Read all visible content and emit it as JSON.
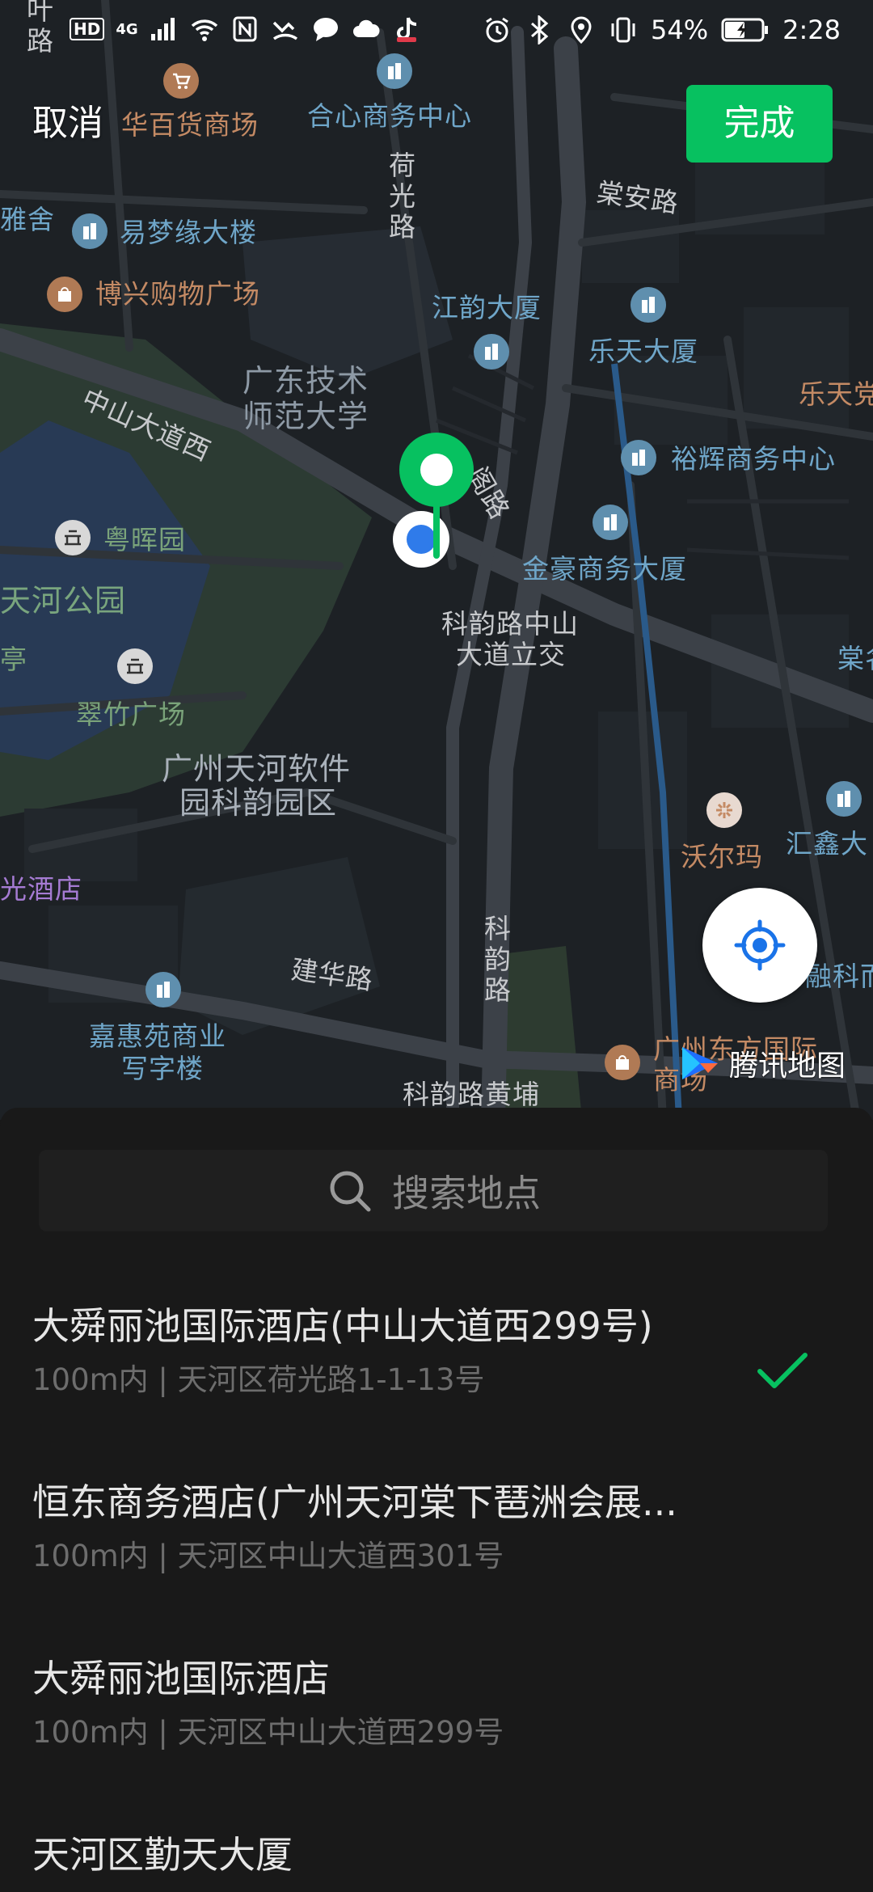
{
  "status_bar": {
    "hd": "HD",
    "net": "4G",
    "battery": "54%",
    "time": "2:28"
  },
  "header": {
    "cancel_label": "取消",
    "done_label": "完成"
  },
  "map": {
    "labels": {
      "ye_lu": "叶路",
      "huabaihuo": "华百货商场",
      "hexin": "合心商务中心",
      "heguang_lu": "荷光路",
      "tangan_lu": "棠安路",
      "yashe": "雅舍",
      "yimengyuan": "易梦缘大楼",
      "boxing": "博兴购物广场",
      "jiangyun": "江韵大厦",
      "letian": "乐天大厦",
      "letian_right": "乐天党",
      "gdjs": "广东技术",
      "gdjs2": "师范大学",
      "zhongshan": "中山大道西",
      "yuhui": "裕辉商务中心",
      "hui_lu": "阁路",
      "yuehuiyuan": "粤晖园",
      "jinhao": "金豪商务大厦",
      "tianhe_park": "天河公园",
      "keyun1": "科韵路中山",
      "keyun2": "大道立交",
      "ting": "亭",
      "cuizhu": "翠竹广场",
      "tang_right": "棠名",
      "software1": "广州天河软件",
      "software2": "园科韵园区",
      "walmart": "沃尔玛",
      "huixin": "汇鑫大",
      "guang_hotel": "光酒店",
      "keyun_lu": "科韵路",
      "jianhua_lu": "建华路",
      "ronghua": "融科而",
      "jiahuiyuan1": "嘉惠苑商业",
      "jiahuiyuan2": "写字楼",
      "huangpu": "科韵路黄埔",
      "guangzhou_dongfang": "广州东方国际",
      "shangchang": "商场"
    },
    "logo_text": "腾讯地图",
    "icons": [
      "cart-icon",
      "building-icon",
      "shop-icon",
      "park-icon",
      "walmart-icon",
      "locate-icon",
      "pin-icon",
      "current-location-icon"
    ]
  },
  "sheet": {
    "search_placeholder": "搜索地点",
    "results": [
      {
        "title": "大舜丽池国际酒店(中山大道西299号)",
        "sub": "100m内 | 天河区荷光路1-1-13号",
        "selected": true
      },
      {
        "title": "恒东商务酒店(广州天河棠下琶洲会展...",
        "sub": "100m内 | 天河区中山大道西301号",
        "selected": false
      },
      {
        "title": "大舜丽池国际酒店",
        "sub": "100m内 | 天河区中山大道西299号",
        "selected": false
      },
      {
        "title": "天河区勤天大厦",
        "sub": "",
        "selected": false
      }
    ]
  },
  "colors": {
    "accent": "#07c160",
    "map_bg": "#1d2125",
    "sheet_bg": "#191919"
  }
}
